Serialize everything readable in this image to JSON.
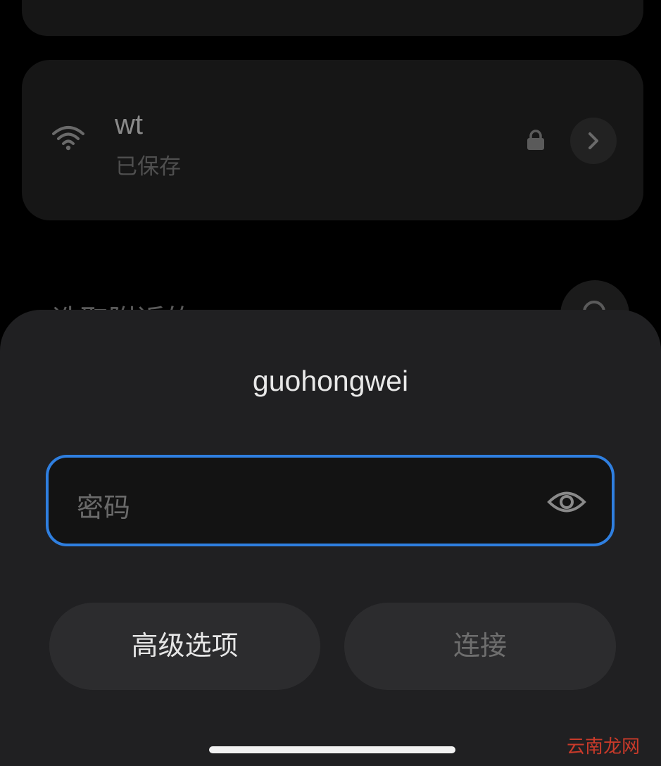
{
  "saved_networks": {
    "network": {
      "name": "wt",
      "status": "已保存",
      "icons": [
        "wifi-icon",
        "lock-icon",
        "chevron-right-icon"
      ]
    }
  },
  "nearby": {
    "section_title": "选取附近的WLAN",
    "refresh_icon": "search-icon"
  },
  "dialog": {
    "title": "guohongwei",
    "password_placeholder": "密码",
    "password_value": "",
    "visibility_icon": "eye-icon",
    "advanced_label": "高级选项",
    "connect_label": "连接"
  },
  "watermark": "云南龙网",
  "colors": {
    "accent": "#2f7fe0",
    "sheet_bg": "#202022",
    "card_bg": "#161616"
  }
}
